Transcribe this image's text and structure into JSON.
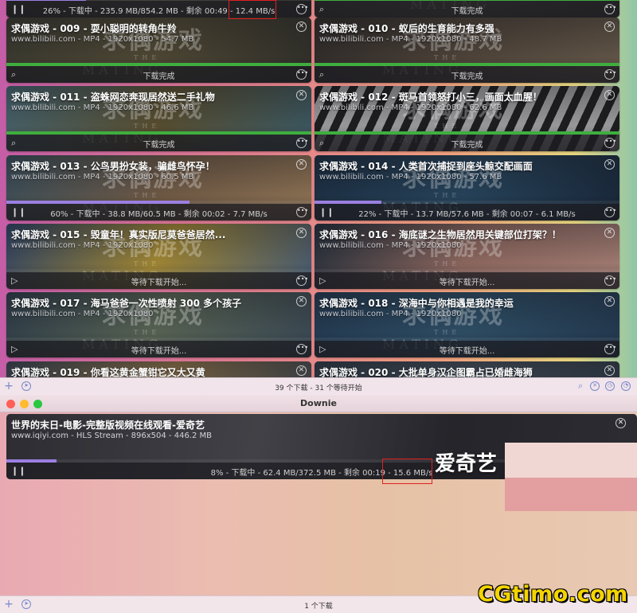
{
  "window1": {
    "top_status": "26% - 下载中 - 235.9 MB/854.2 MB - 剩余 00:49 - 12.4 MB/s",
    "top_status_right": "下载完成",
    "watermark_main": "求偶游戏",
    "watermark_sub": "MATING",
    "watermark_the": "THE",
    "cards": [
      {
        "title": "求偶游戏 - 009 - 耍小聪明的转角牛羚",
        "meta": "www.bilibili.com - MP4 - 1920x1080 - 54.7 MB",
        "status": "下载完成",
        "progress": 1.0,
        "color": "#3fae3f",
        "icon": "search-icon",
        "bg": "linear-gradient(120deg,#4a4a3a,#6b6040,#3a3a30)"
      },
      {
        "title": "求偶游戏 - 010 - 蚁后的生育能力有多强",
        "meta": "www.bilibili.com - MP4 - 1920x1080 - 48.7 MB",
        "status": "下载完成",
        "progress": 1.0,
        "color": "#3fae3f",
        "icon": "search-icon",
        "bg": "linear-gradient(120deg,#3a3530,#6a5a48,#8a7860)"
      },
      {
        "title": "求偶游戏 - 011 - 盗蛛网恋奔现居然送二手礼物",
        "meta": "www.bilibili.com - MP4 - 1920x1080 - 46.6 MB",
        "status": "下载完成",
        "progress": 1.0,
        "color": "#3fae3f",
        "icon": "search-icon",
        "bg": "linear-gradient(120deg,#5a8a9a,#7a6a3a,#4a7a8a)"
      },
      {
        "title": "求偶游戏 - 012 - 斑马首领怒打小三，画面太血腥！",
        "meta": "www.bilibili.com - MP4 - 1920x1080 - 62.6 MB",
        "status": "下载完成",
        "progress": 1.0,
        "color": "#3fae3f",
        "icon": "search-icon",
        "bg": "repeating-linear-gradient(115deg,#222 0 10px,#ddd 10px 20px)"
      },
      {
        "title": "求偶游戏 - 013 - 公鸟男扮女装，骗雌鸟怀孕！",
        "meta": "www.bilibili.com - MP4 - 1920x1080 - 60.5 MB",
        "status": "60% - 下载中 - 38.8 MB/60.5 MB - 剩余 00:02 - 7.7 MB/s",
        "progress": 0.6,
        "color": "#9b7fe0",
        "icon": "pause-icon",
        "bg": "linear-gradient(120deg,#4a6a7a,#9a7a5a,#c8a070)"
      },
      {
        "title": "求偶游戏 - 014 - 人类首次捕捉到座头鲸交配画面",
        "meta": "www.bilibili.com - MP4 - 1920x1080 - 57.6 MB",
        "status": "22% - 下载中 - 13.7 MB/57.6 MB - 剩余 00:07 - 6.1 MB/s",
        "progress": 0.22,
        "color": "#9b7fe0",
        "icon": "pause-icon",
        "bg": "linear-gradient(120deg,#1f3a55,#2f5a7a,#1a3048)"
      },
      {
        "title": "求偶游戏 - 015 - 毁童年！真实版尼莫爸爸居然...",
        "meta": "www.bilibili.com - MP4 - 1920x1080",
        "status": "等待下载开始...",
        "progress": 0,
        "color": "#9b7fe0",
        "icon": "play-icon",
        "bg": "linear-gradient(120deg,#3a5a8a,#e8c040,#5a7aa0)"
      },
      {
        "title": "求偶游戏 - 016 - 海底谜之生物居然用关键部位打架？！",
        "meta": "www.bilibili.com - MP4 - 1920x1080",
        "status": "等待下载开始...",
        "progress": 0,
        "color": "#9b7fe0",
        "icon": "play-icon",
        "bg": "linear-gradient(120deg,#2a3a4a,#c89080,#e8b0a0)"
      },
      {
        "title": "求偶游戏 - 017 - 海马爸爸一次性喷射 300 多个孩子",
        "meta": "www.bilibili.com - MP4 - 1920x1080",
        "status": "等待下载开始...",
        "progress": 0,
        "color": "#9b7fe0",
        "icon": "play-icon",
        "bg": "linear-gradient(120deg,#3a5060,#7a8a70,#4a6070)"
      },
      {
        "title": "求偶游戏 - 018 - 深海中与你相遇是我的幸运",
        "meta": "www.bilibili.com - MP4 - 1920x1080",
        "status": "等待下载开始...",
        "progress": 0,
        "color": "#9b7fe0",
        "icon": "play-icon",
        "bg": "linear-gradient(120deg,#2a4a6a,#3a6a8a,#2a4a6a)"
      },
      {
        "title": "求偶游戏 - 019 - 你看这黄金蟹钳它又大又黄",
        "meta": "",
        "status": "",
        "progress": 0,
        "color": "#9b7fe0",
        "icon": "play-icon",
        "bg": "linear-gradient(120deg,#4a5a6a,#c8a060,#4a5a6a)"
      },
      {
        "title": "求偶游戏 - 020 - 大批单身汉企图霸占已婚雌海狮",
        "meta": "",
        "status": "",
        "progress": 0,
        "color": "#9b7fe0",
        "icon": "play-icon",
        "bg": "linear-gradient(120deg,#3a4a5a,#5a6a7a,#3a4a5a)"
      }
    ],
    "footer_text": "39 个下载 - 31 个等待开始"
  },
  "window2": {
    "title": "Downie",
    "card": {
      "title": "世界的末日-电影-完整版视频在线观看-爱奇艺",
      "meta": "www.iqiyi.com - HLS Stream - 896x504 - 446.2 MB",
      "status": "8% - 下载中 - 62.4 MB/372.5 MB - 剩余 00:19 - 15.6 MB/s",
      "progress": 0.08,
      "color": "#9b7fe0"
    },
    "overlay_label": "爱奇艺",
    "footer_text": "1 个下载"
  },
  "brand_watermark": "CGtimo.com",
  "colors": {
    "done": "#3fae3f",
    "downloading": "#9b7fe0",
    "highlight": "#e02020"
  }
}
